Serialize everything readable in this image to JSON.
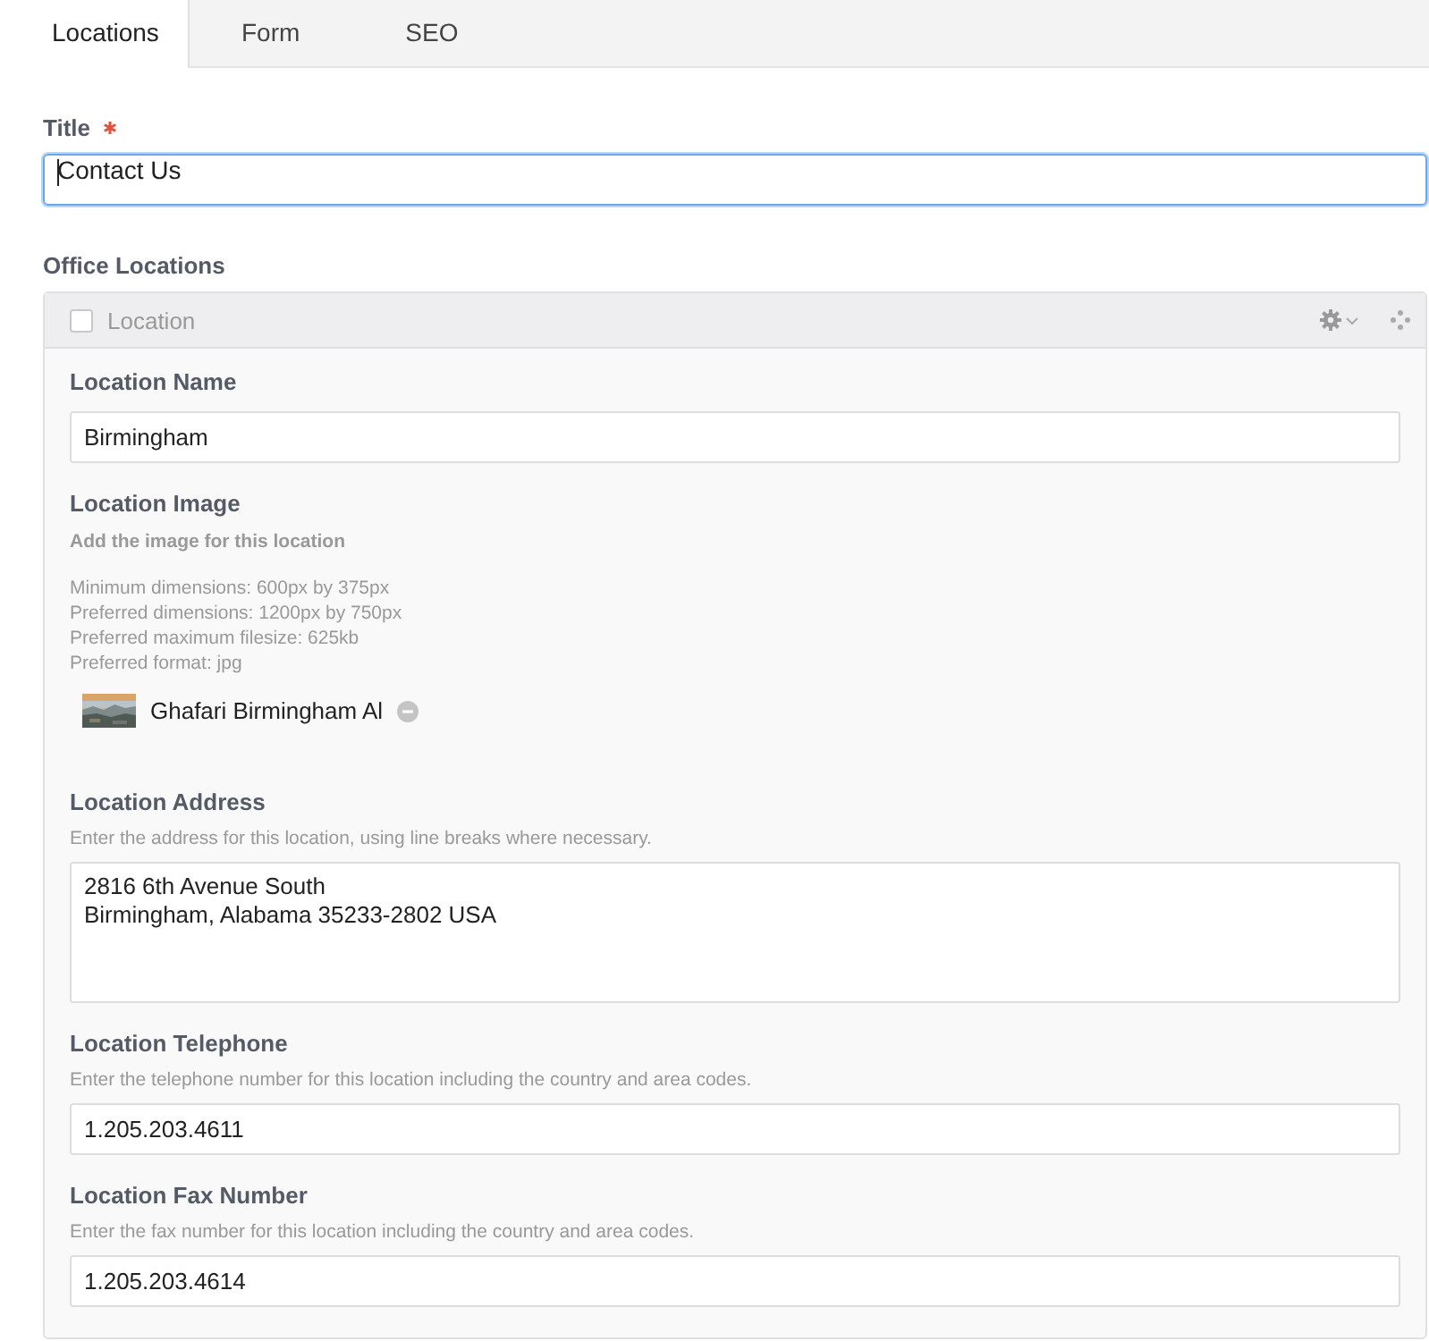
{
  "tabs": [
    {
      "label": "Locations",
      "selected": true
    },
    {
      "label": "Form",
      "selected": false
    },
    {
      "label": "SEO",
      "selected": false
    }
  ],
  "title_field": {
    "label": "Title",
    "required": true,
    "value": "Contact Us",
    "focused": true
  },
  "office_locations": {
    "label": "Office Locations",
    "item": {
      "label": "Location",
      "checked": false,
      "fields": [
        {
          "kind": "text",
          "label": "Location Name",
          "value": "Birmingham"
        },
        {
          "label": "Location Image",
          "instruction": "Add the image for this location",
          "notes": [
            "Minimum dimensions: 600px by 375px",
            "Preferred dimensions: 1200px by 750px",
            "Preferred maximum filesize: 625kb",
            "Preferred format: jpg"
          ],
          "file": {
            "kind": "picture",
            "name": "Ghafari Birmingham Al"
          }
        },
        {
          "kind": "textarea",
          "label": "Location Address",
          "hint": "Enter the address for this location, using line breaks where necessary.",
          "lines": [
            "2816 6th Avenue South",
            "Birmingham, Alabama 35233-2802 USA"
          ]
        },
        {
          "kind": "text",
          "label": "Location Telephone",
          "hint": "Enter the telephone number for this location including the country and area codes.",
          "value": "1.205.203.4611"
        },
        {
          "kind": "text",
          "label": "Location Fax Number",
          "hint": "Enter the fax number for this location including the country and area codes.",
          "value": "1.205.203.4614"
        }
      ]
    }
  }
}
